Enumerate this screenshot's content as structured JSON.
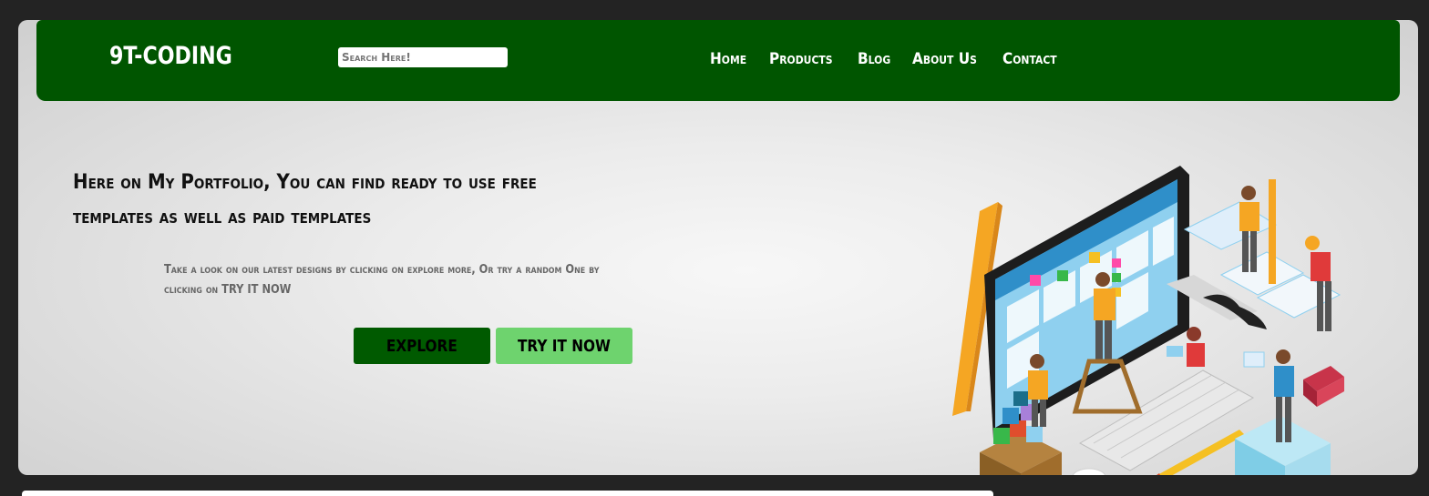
{
  "header": {
    "logo": "9T-CODING",
    "search_placeholder": "Search Here!",
    "nav": [
      "Home",
      "Products",
      "Blog",
      "About Us",
      "Contact"
    ]
  },
  "hero": {
    "headline_line1": "Here on My Portfolio, You can find ready to use free",
    "headline_line2": "templates as well as paid templates",
    "subtext_line1": "Take a look on our latest designs by clicking on explore more, Or try a random One by",
    "subtext_line2": "clicking on TRY IT NOW",
    "explore_label": "EXPLORE",
    "try_label": "TRY IT NOW"
  },
  "colors": {
    "navbar": "#005500",
    "explore_button": "#005a00",
    "try_button": "#6ed36e",
    "page_background": "#232323"
  },
  "illustration": {
    "icon": "web-design-team-illustration"
  }
}
